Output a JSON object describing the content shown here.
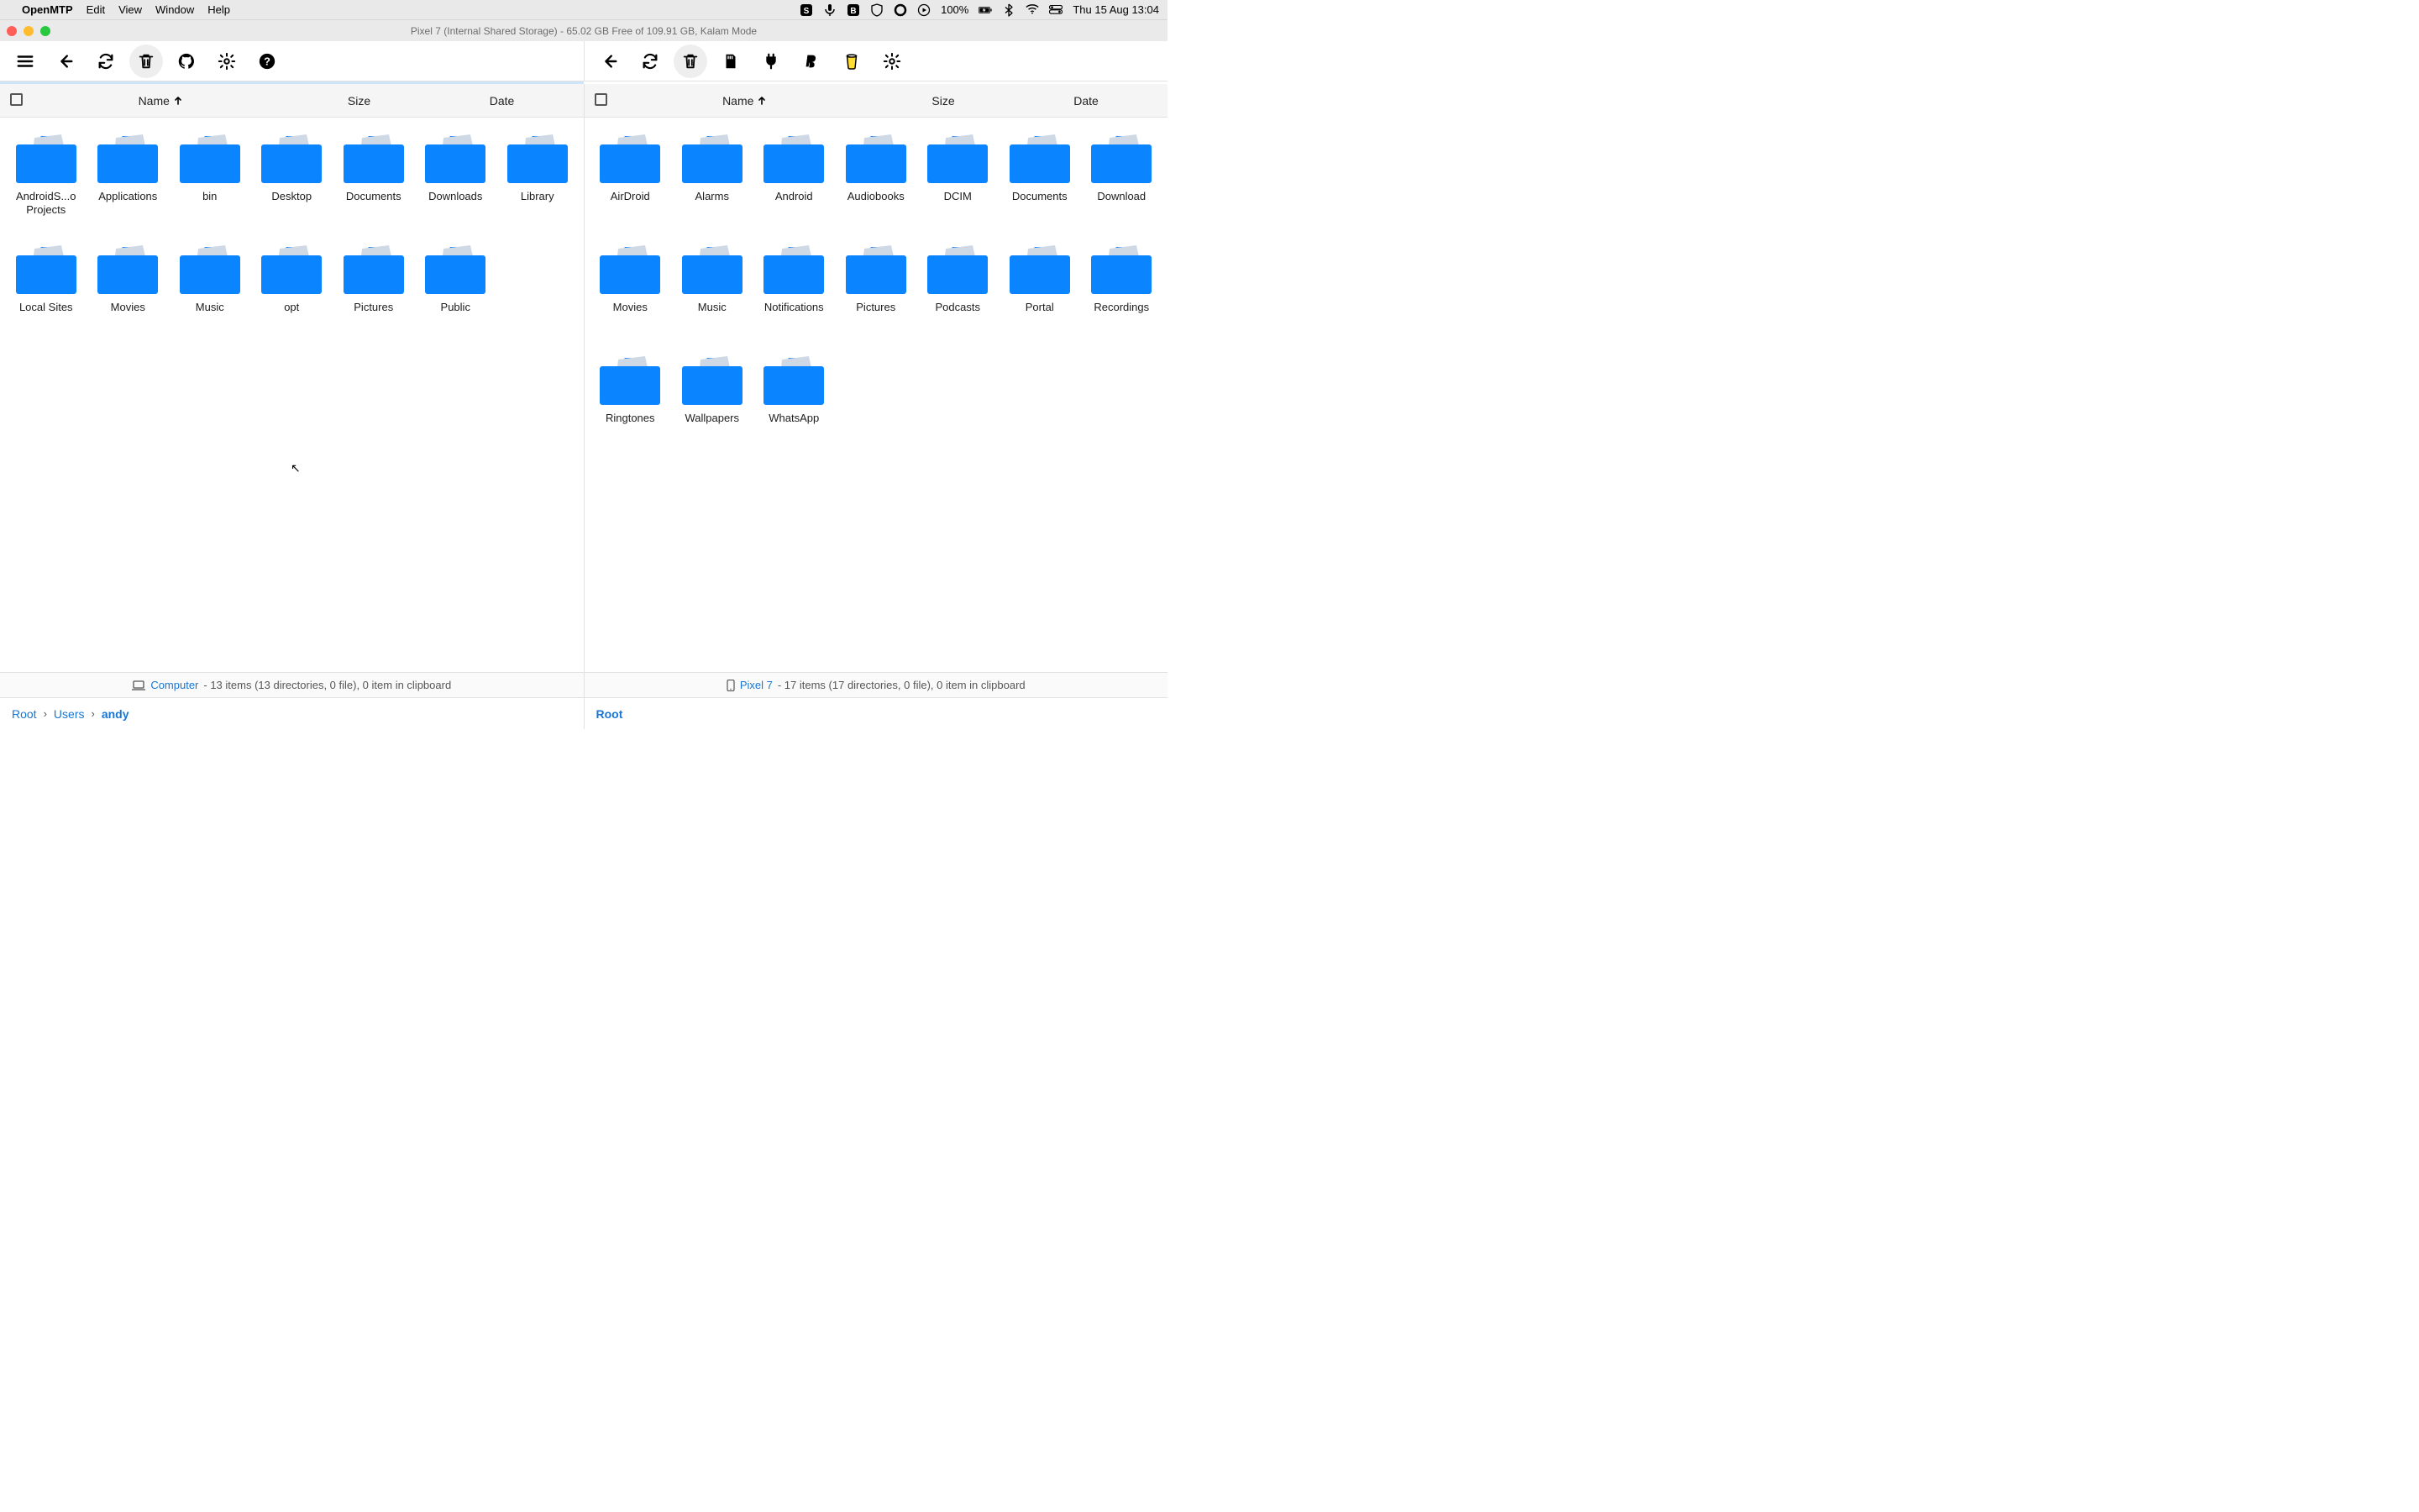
{
  "menubar": {
    "app": "OpenMTP",
    "items": [
      "Edit",
      "View",
      "Window",
      "Help"
    ],
    "battery": "100%",
    "datetime": "Thu 15 Aug  13:04"
  },
  "window": {
    "title": "Pixel 7 (Internal Shared Storage) - 65.02 GB Free of 109.91 GB, Kalam Mode"
  },
  "colheaders": {
    "name": "Name",
    "size": "Size",
    "date": "Date"
  },
  "left": {
    "folders": [
      {
        "label": "AndroidS...o Projects"
      },
      {
        "label": "Applications"
      },
      {
        "label": "bin"
      },
      {
        "label": "Desktop"
      },
      {
        "label": "Documents"
      },
      {
        "label": "Downloads"
      },
      {
        "label": "Library"
      },
      {
        "label": "Local Sites"
      },
      {
        "label": "Movies"
      },
      {
        "label": "Music"
      },
      {
        "label": "opt"
      },
      {
        "label": "Pictures"
      },
      {
        "label": "Public"
      }
    ],
    "status": {
      "device": "Computer",
      "rest": " - 13 items (13 directories, 0 file), 0 item in clipboard"
    },
    "breadcrumb": [
      "Root",
      "Users",
      "andy"
    ]
  },
  "right": {
    "folders": [
      {
        "label": "AirDroid"
      },
      {
        "label": "Alarms"
      },
      {
        "label": "Android"
      },
      {
        "label": "Audiobooks"
      },
      {
        "label": "DCIM"
      },
      {
        "label": "Documents"
      },
      {
        "label": "Download"
      },
      {
        "label": "Movies"
      },
      {
        "label": "Music"
      },
      {
        "label": "Notifications"
      },
      {
        "label": "Pictures"
      },
      {
        "label": "Podcasts"
      },
      {
        "label": "Portal"
      },
      {
        "label": "Recordings"
      },
      {
        "label": "Ringtones"
      },
      {
        "label": "Wallpapers"
      },
      {
        "label": "WhatsApp"
      }
    ],
    "status": {
      "device": "Pixel 7",
      "rest": " - 17 items (17 directories, 0 file), 0 item in clipboard"
    },
    "breadcrumb": [
      "Root"
    ]
  }
}
